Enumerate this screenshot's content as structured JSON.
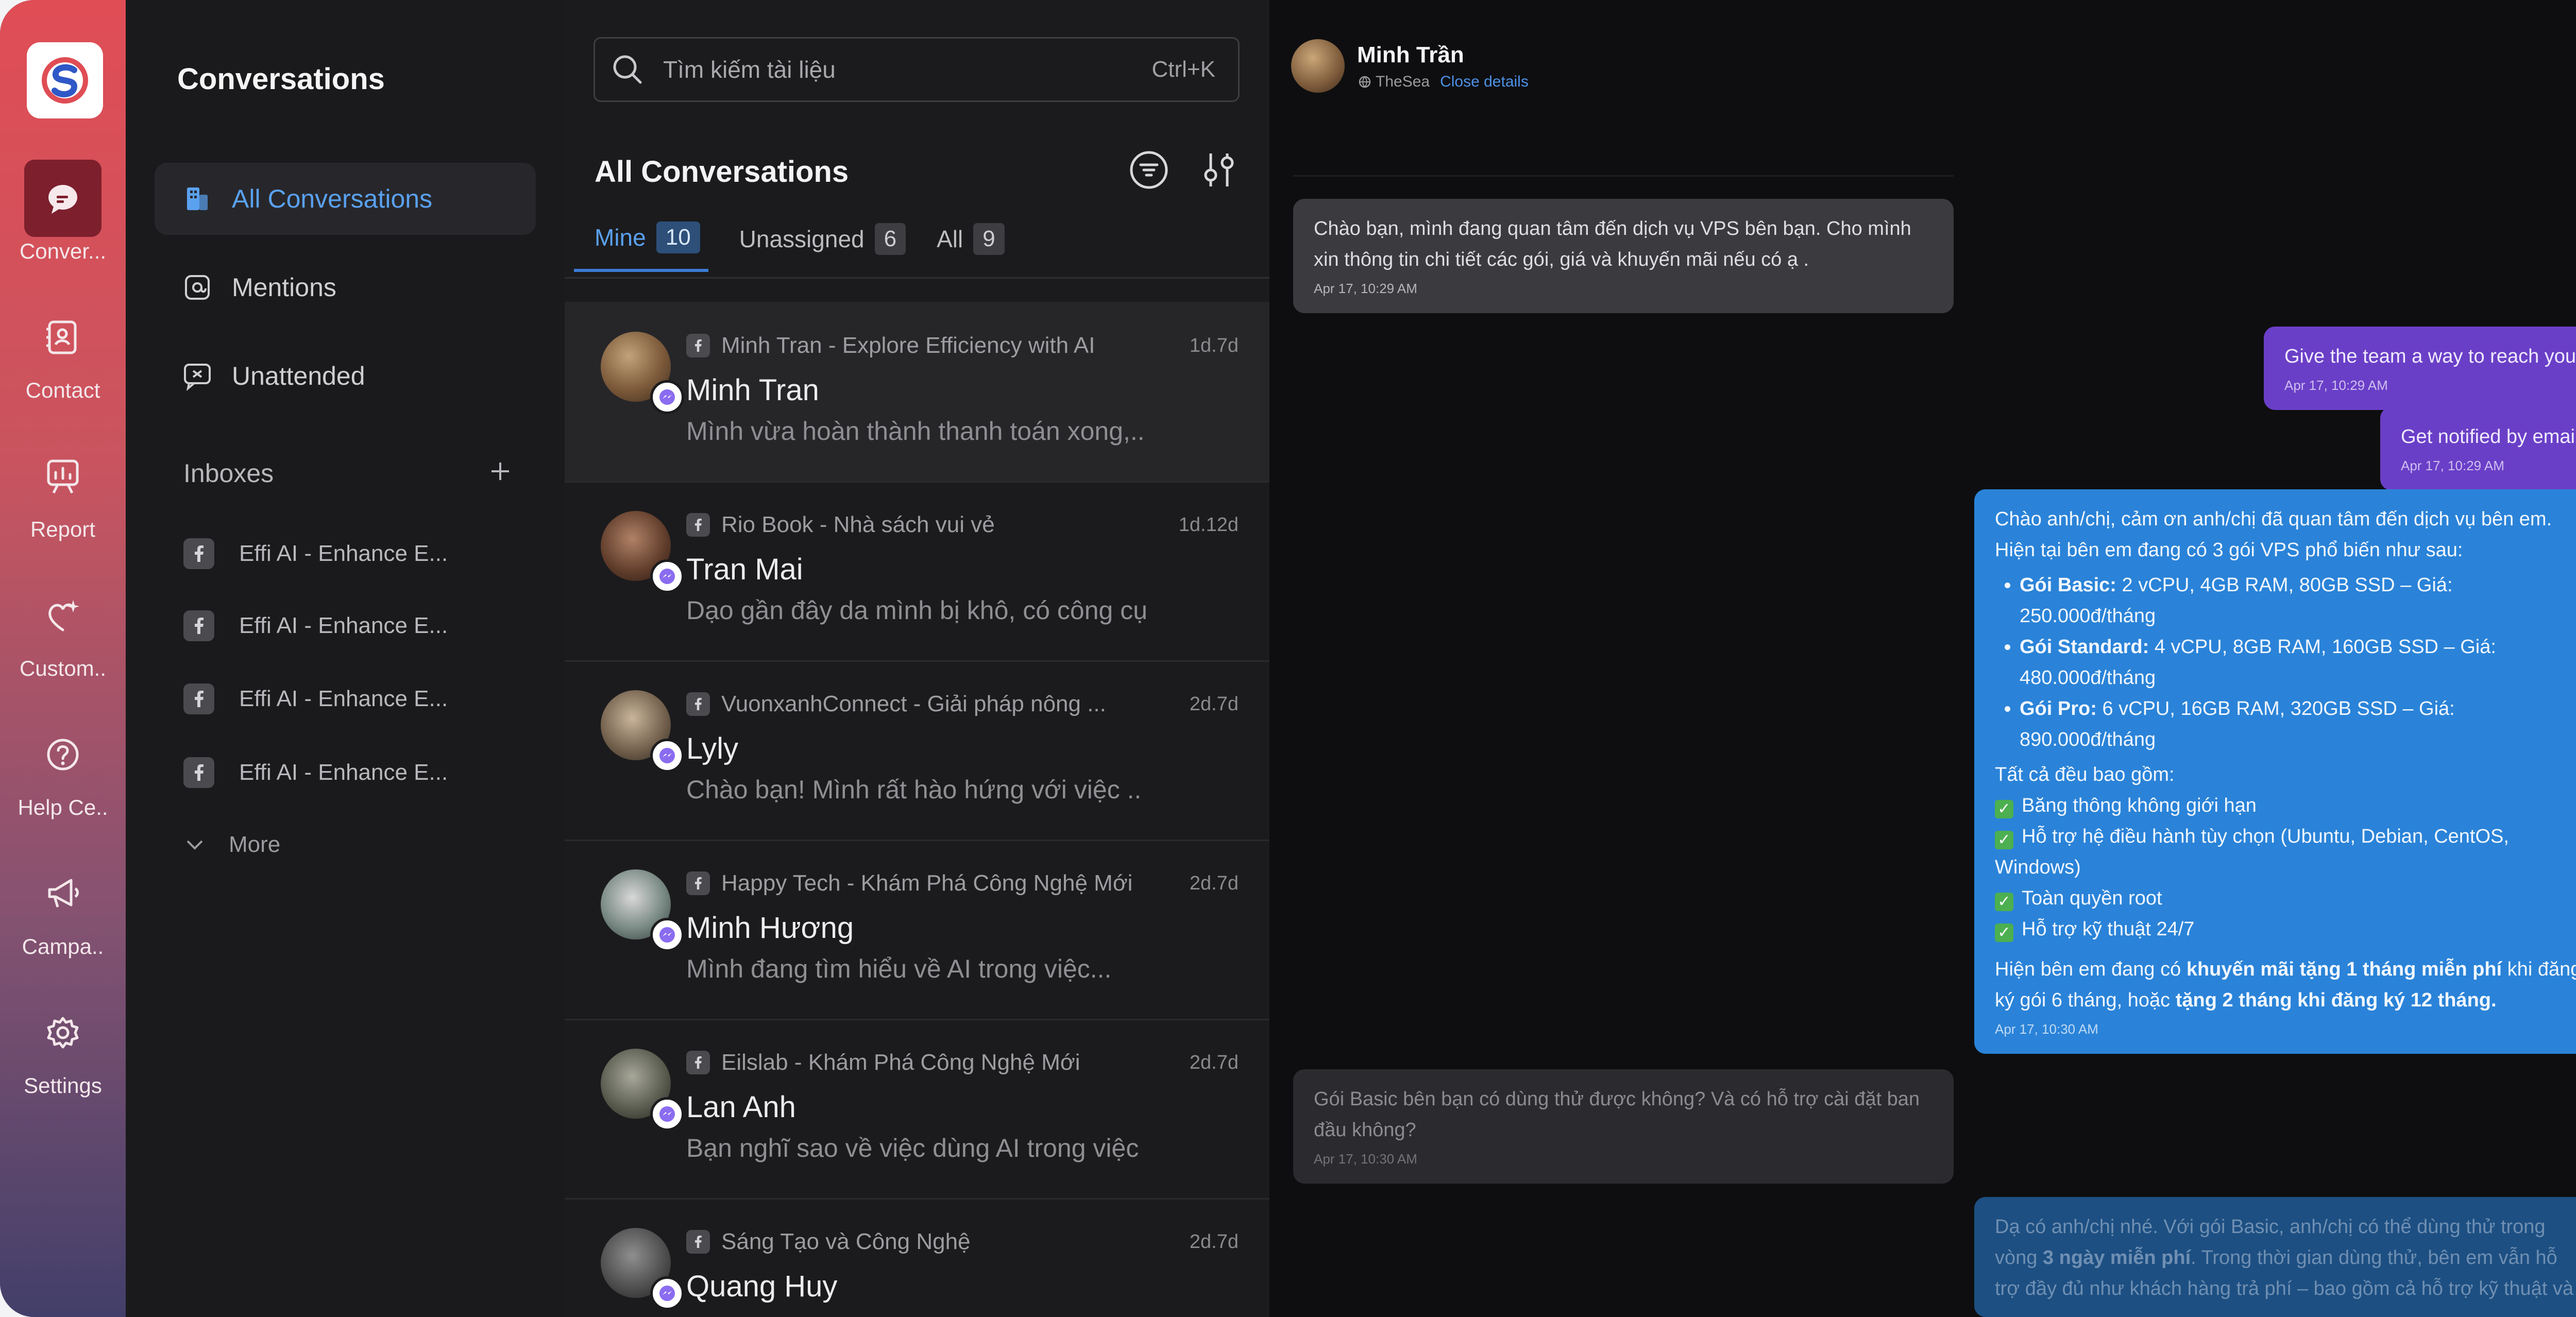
{
  "rail": {
    "items": [
      {
        "label": "Conver...",
        "icon": "chat-bubble-icon",
        "active": true
      },
      {
        "label": "Contact",
        "icon": "contact-card-icon"
      },
      {
        "label": "Report",
        "icon": "report-chart-icon"
      },
      {
        "label": "Custom..",
        "icon": "customer-sparkle-icon"
      },
      {
        "label": "Help Ce..",
        "icon": "help-circle-icon"
      },
      {
        "label": "Campa..",
        "icon": "megaphone-icon"
      },
      {
        "label": "Settings",
        "icon": "gear-icon"
      }
    ]
  },
  "sidebar": {
    "title": "Conversations",
    "nav": [
      {
        "label": "All Conversations",
        "active": true
      },
      {
        "label": "Mentions"
      },
      {
        "label": "Unattended"
      }
    ],
    "inboxes_label": "Inboxes",
    "inboxes": [
      "Effi AI - Enhance E...",
      "Effi AI - Enhance E...",
      "Effi AI - Enhance E...",
      "Effi AI - Enhance E..."
    ],
    "more_label": "More"
  },
  "list": {
    "search_placeholder": "Tìm kiếm tài liệu",
    "search_shortcut": "Ctrl+K",
    "title": "All Conversations",
    "tabs": [
      {
        "label": "Mine",
        "count": "10",
        "active": true
      },
      {
        "label": "Unassigned",
        "count": "6"
      },
      {
        "label": "All",
        "count": "9"
      }
    ],
    "conversations": [
      {
        "source": "Minh Tran - Explore Efficiency with AI",
        "time": "1d.7d",
        "name": "Minh Tran",
        "message": "Mình vừa hoàn thành thanh toán xong,..",
        "active": true
      },
      {
        "source": "Rio Book - Nhà sách vui vẻ",
        "time": "1d.12d",
        "name": "Tran Mai",
        "message": "Dạo gần đây da mình bị khô, có công cụ"
      },
      {
        "source": "VuonxanhConnect - Giải pháp nông ...",
        "time": "2d.7d",
        "name": "Lyly",
        "message": "Chào bạn! Mình rất hào hứng với việc .."
      },
      {
        "source": "Happy Tech - Khám Phá Công Nghệ Mới",
        "time": "2d.7d",
        "name": "Minh Hương",
        "message": "Mình đang tìm hiểu về AI trong việc..."
      },
      {
        "source": "Eilslab - Khám Phá Công Nghệ Mới",
        "time": "2d.7d",
        "name": "Lan Anh",
        "message": "Bạn nghĩ sao về việc dùng AI trong việc"
      },
      {
        "source": "Sáng Tạo và Công Nghệ",
        "time": "2d.7d",
        "name": "Quang Huy",
        "message": ""
      }
    ]
  },
  "chat": {
    "contact_name": "Minh Trần",
    "contact_org": "TheSea",
    "close_details": "Close details",
    "messages": {
      "m1_text": "Chào bạn, mình đang quan tâm đến dịch vụ VPS bên bạn. Cho mình xin thông tin chi tiết các gói, giá và khuyến mãi nếu có ạ .",
      "m1_time": "Apr 17, 10:29 AM",
      "m2_text": "Give the team a way to reach you.",
      "m2_time": "Apr 17, 10:29 AM",
      "m3_text": "Get notified by email",
      "m3_time": "Apr 17, 10:29 AM",
      "m4_intro": "Chào anh/chị, cảm ơn anh/chị đã quan tâm đến dịch vụ bên em. Hiện tại bên em đang có 3 gói VPS phổ biến như sau:",
      "m4_plans": [
        {
          "name": "Gói Basic:",
          "desc": " 2 vCPU, 4GB RAM, 80GB SSD – Giá: 250.000đ/tháng"
        },
        {
          "name": "Gói Standard:",
          "desc": " 4 vCPU, 8GB RAM, 160GB SSD – Giá: 480.000đ/tháng"
        },
        {
          "name": "Gói Pro:",
          "desc": " 6 vCPU, 16GB RAM, 320GB SSD – Giá: 890.000đ/tháng"
        }
      ],
      "m4_includes": "Tất cả đều bao gồm:",
      "m4_features": [
        "Băng thông không giới hạn",
        "Hỗ trợ hệ điều hành tùy chọn (Ubuntu, Debian, CentOS, Windows)",
        "Toàn quyền root",
        "Hỗ trợ kỹ thuật 24/7"
      ],
      "m4_promo_a": "Hiện bên em đang có ",
      "m4_promo_b": "khuyến mãi tặng 1 tháng miễn phí",
      "m4_promo_c": " khi đăng ký gói 6 tháng, hoặc ",
      "m4_promo_d": "tặng 2 tháng khi đăng ký 12 tháng.",
      "m4_time": "Apr 17, 10:30 AM",
      "m5_text": "Gói Basic bên bạn có dùng thử được không? Và có hỗ trợ cài đặt ban đầu không?",
      "m5_time": "Apr 17, 10:30 AM",
      "m6_a": "Dạ có anh/chị nhé. Với gói Basic, anh/chị có thể dùng thử trong vòng ",
      "m6_b": "3 ngày miễn phí",
      "m6_c": ". Trong thời gian dùng thử, bên em vẫn hỗ trợ đầy đủ như khách hàng trả phí – bao gồm cả hỗ trợ kỹ thuật và"
    }
  }
}
